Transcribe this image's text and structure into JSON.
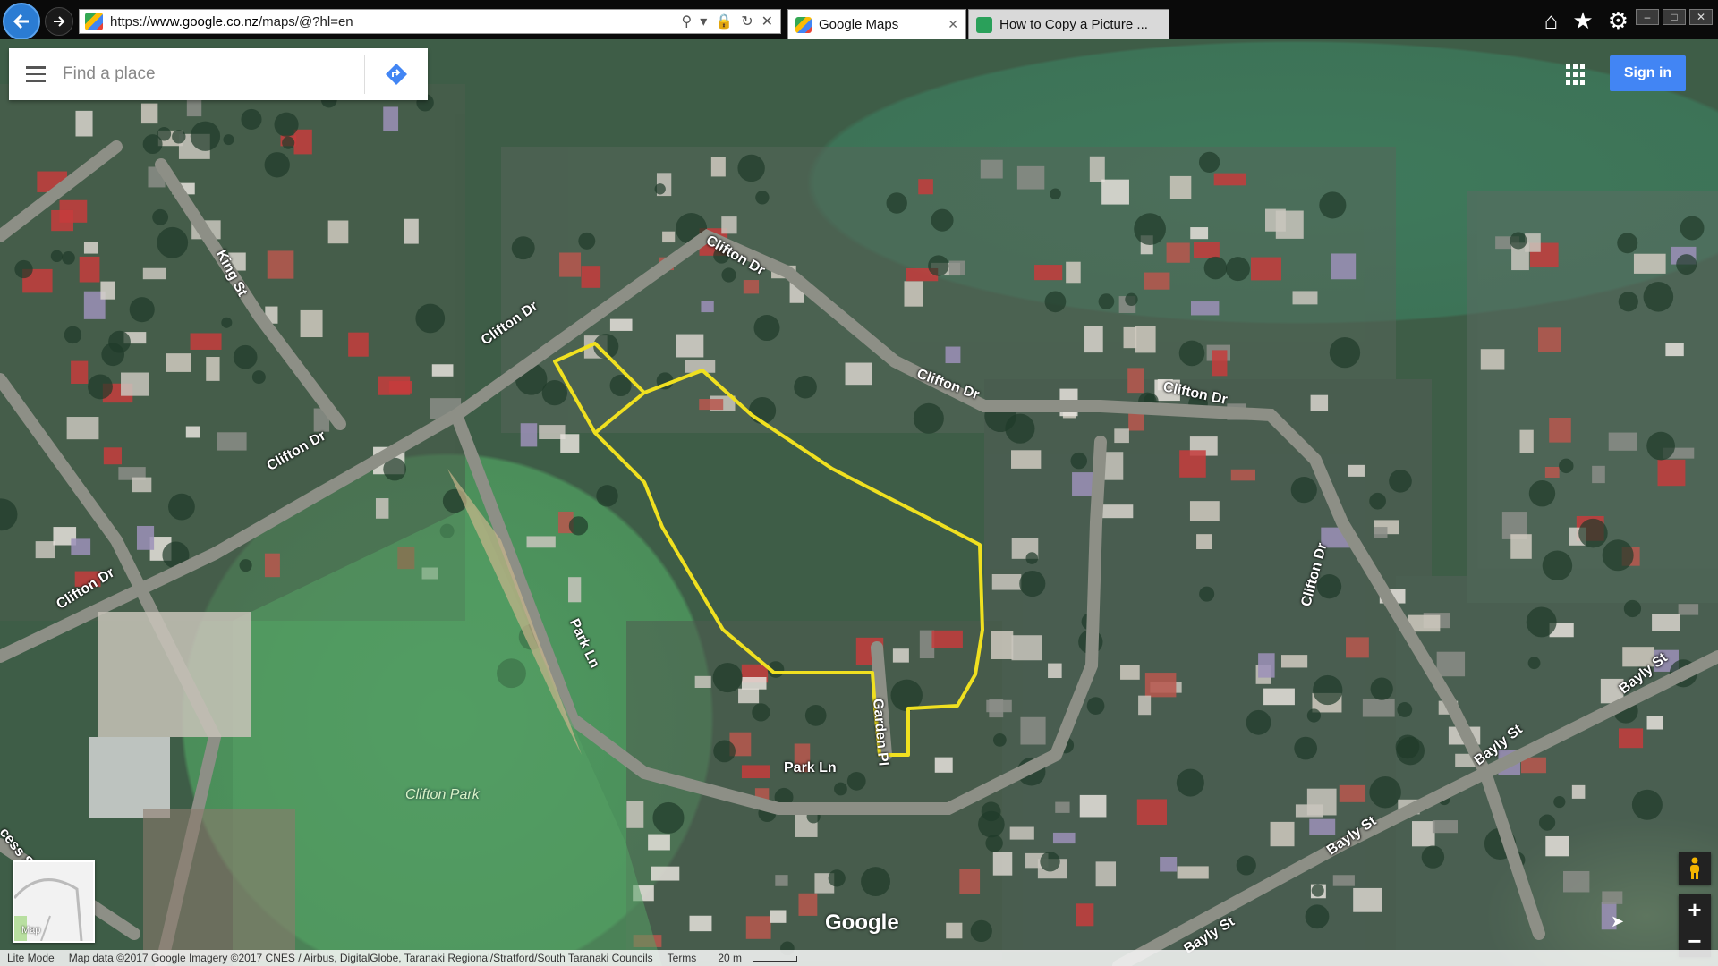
{
  "browser": {
    "url_scheme": "https://",
    "url_host": "www.google.co.nz",
    "url_path": "/maps/@?hl=en",
    "tabs": [
      {
        "label": "Google Maps",
        "active": true
      },
      {
        "label": "How to Copy a Picture ...",
        "active": false
      }
    ],
    "icons": [
      "back-arrow-icon",
      "forward-arrow-icon",
      "search-icon",
      "lock-icon",
      "refresh-icon",
      "stop-icon",
      "home-icon",
      "favorites-star-icon",
      "settings-gear-icon"
    ]
  },
  "maps": {
    "search_placeholder": "Find a place",
    "signin_label": "Sign in",
    "watermark": "Google",
    "minimap_label": "Map",
    "zoom_in": "+",
    "zoom_out": "−",
    "accent_color": "#4285f4",
    "boundary_color": "#f0e020"
  },
  "streets": [
    "King St",
    "Clifton Dr",
    "Clifton Dr",
    "Clifton Dr",
    "Clifton Dr",
    "Clifton Dr",
    "Clifton Dr",
    "Clifton Dr",
    "Park Ln",
    "Park Ln",
    "Garden Pl",
    "Bayly St",
    "Bayly St",
    "Bayly St",
    "Bayly St",
    "cess St"
  ],
  "park_label": "Clifton Park",
  "footer": {
    "mode": "Lite Mode",
    "attribution": "Map data ©2017 Google Imagery ©2017 CNES / Airbus, DigitalGlobe, Taranaki Regional/Stratford/South Taranaki Councils",
    "terms": "Terms",
    "scale": "20 m"
  }
}
